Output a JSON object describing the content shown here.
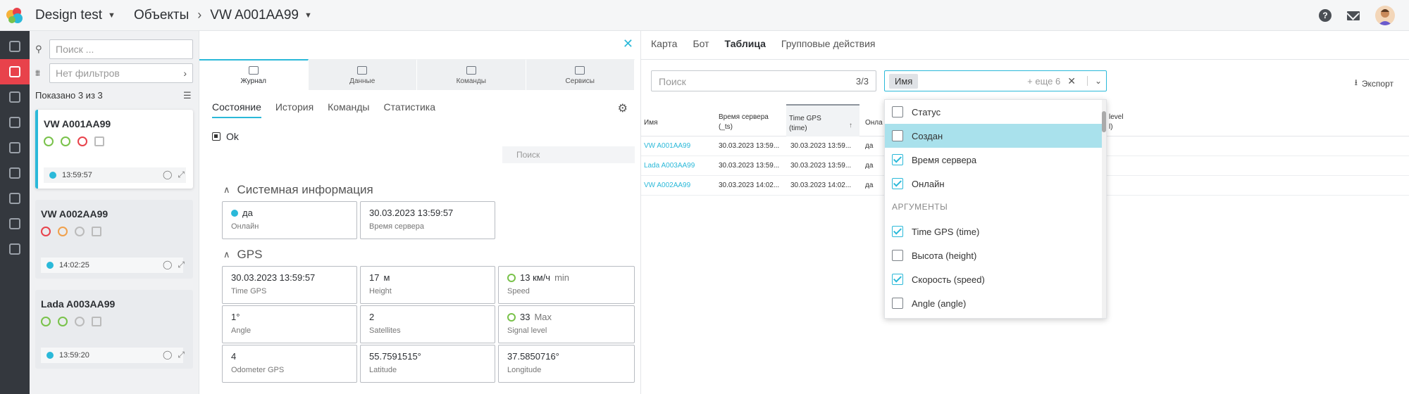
{
  "header": {
    "workspace": "Design test",
    "section": "Объекты",
    "object": "VW A001AA99"
  },
  "objects_panel": {
    "search_placeholder": "Поиск ...",
    "filter_placeholder": "Нет фильтров",
    "shown_text": "Показано 3 из 3",
    "items": [
      {
        "name": "VW A001AA99",
        "time": "13:59:57"
      },
      {
        "name": "VW A002AA99",
        "time": "14:02:25"
      },
      {
        "name": "Lada A003AA99",
        "time": "13:59:20"
      }
    ]
  },
  "detail": {
    "tabs": [
      "Журнал",
      "Данные",
      "Команды",
      "Сервисы"
    ],
    "subtabs": [
      "Состояние",
      "История",
      "Команды",
      "Статистика"
    ],
    "status_text": "Ok",
    "search_placeholder": "Поиск",
    "system_title": "Системная информация",
    "system": [
      {
        "value": "да",
        "label": "Онлайн"
      },
      {
        "value": "30.03.2023 13:59:57",
        "label": "Время сервера"
      }
    ],
    "gps_title": "GPS",
    "gps": [
      {
        "value": "30.03.2023 13:59:57",
        "unit": "",
        "label": "Time GPS"
      },
      {
        "value": "17",
        "unit": "м",
        "label": "Height"
      },
      {
        "value": "13 км/ч",
        "unit": "min",
        "label": "Speed"
      },
      {
        "value": "1°",
        "unit": "",
        "label": "Angle"
      },
      {
        "value": "2",
        "unit": "",
        "label": "Satellites"
      },
      {
        "value": "33",
        "unit": "Max",
        "label": "Signal level"
      },
      {
        "value": "4",
        "unit": "",
        "label": "Odometer GPS"
      },
      {
        "value": "55.7591515°",
        "unit": "",
        "label": "Latitude"
      },
      {
        "value": "37.5850716°",
        "unit": "",
        "label": "Longitude"
      }
    ]
  },
  "table_panel": {
    "tabs": [
      "Карта",
      "Бот",
      "Таблица",
      "Групповые действия"
    ],
    "search_placeholder": "Поиск",
    "search_count": "3/3",
    "column_chip": "Имя",
    "column_more": "+ еще 6",
    "export_label": "Экспорт",
    "headers": {
      "name": "Имя",
      "server_time_1": "Время сервера",
      "server_time_2": "(_ts)",
      "gps_time_1": "Time GPS",
      "gps_time_2": "(time)",
      "online": "Онла",
      "level_1": "level",
      "level_2": "l)"
    },
    "rows": [
      {
        "name": "VW A001AA99",
        "server": "30.03.2023 13:59...",
        "gps": "30.03.2023 13:59...",
        "online": "да"
      },
      {
        "name": "Lada A003AA99",
        "server": "30.03.2023 13:59...",
        "gps": "30.03.2023 13:59...",
        "online": "да"
      },
      {
        "name": "VW A002AA99",
        "server": "30.03.2023 14:02...",
        "gps": "30.03.2023 14:02...",
        "online": "да"
      }
    ]
  },
  "dropdown": {
    "items": [
      {
        "label": "Статус",
        "checked": false
      },
      {
        "label": "Создан",
        "checked": false
      },
      {
        "label": "Время сервера",
        "checked": true
      },
      {
        "label": "Онлайн",
        "checked": true
      }
    ],
    "group": "АРГУМЕНТЫ",
    "args": [
      {
        "label": "Time GPS (time)",
        "checked": true
      },
      {
        "label": "Высота (height)",
        "checked": false
      },
      {
        "label": "Скорость (speed)",
        "checked": true
      },
      {
        "label": "Angle (angle)",
        "checked": false
      }
    ]
  }
}
